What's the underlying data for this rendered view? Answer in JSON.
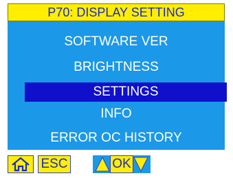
{
  "title": "P70: DISPLAY SETTING",
  "menu": {
    "items": [
      {
        "label": "SOFTWARE VER"
      },
      {
        "label": "BRIGHTNESS"
      },
      {
        "label": "SETTINGS"
      },
      {
        "label": "INFO"
      },
      {
        "label": "ERROR OC HISTORY"
      }
    ],
    "selected": "SETTINGS"
  },
  "footer": {
    "home_icon": "home-icon",
    "esc_label": "ESC",
    "up_icon": "up-arrow-icon",
    "ok_label": "OK",
    "down_icon": "down-arrow-icon"
  },
  "colors": {
    "title_bg": "#ffee00",
    "menu_bg": "#1b98e8",
    "selected_bg": "#1010cc",
    "text": "#ffffff",
    "button_text": "#1a2bcc"
  }
}
